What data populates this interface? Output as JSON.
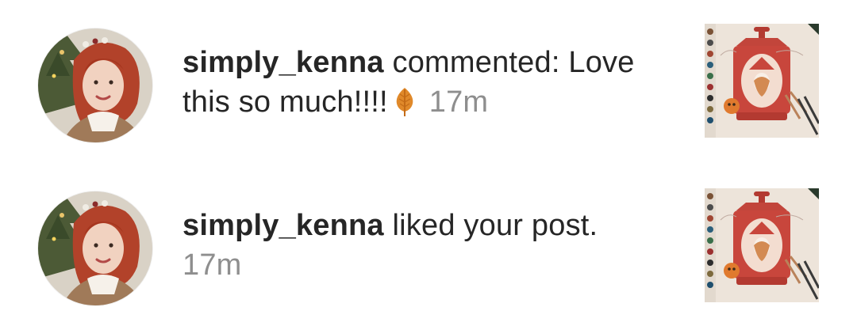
{
  "notifications": [
    {
      "username": "simply_kenna",
      "action": "commented: Love this so much!!!!",
      "emoji": "maple-leaf-icon",
      "time": "17m"
    },
    {
      "username": "simply_kenna",
      "action": "liked your post.",
      "time": "17m"
    }
  ],
  "colors": {
    "text": "#262626",
    "timestamp": "#8e8e8e",
    "leaf": "#e0892a",
    "lantern": "#c53a33"
  }
}
